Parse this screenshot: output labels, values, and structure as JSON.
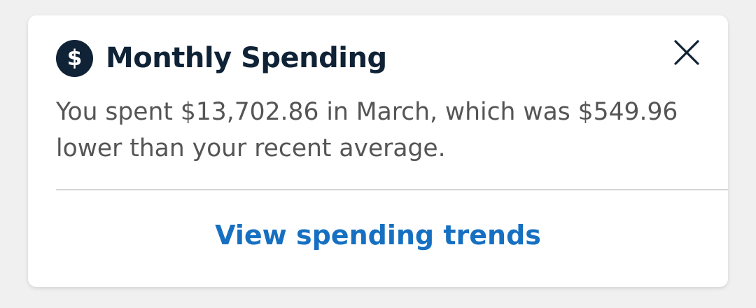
{
  "card": {
    "icon": "dollar-icon",
    "icon_glyph": "$",
    "title": "Monthly Spending",
    "close_icon": "close-icon",
    "message": "You spent $13,702.86 in March, which was $549.96 lower than your recent average.",
    "action_label": "View spending trends"
  },
  "colors": {
    "page_background": "#f0f0f0",
    "card_background": "#ffffff",
    "title": "#0f2236",
    "body_text": "#555555",
    "link": "#1670c2",
    "divider": "#d6d6d6"
  }
}
